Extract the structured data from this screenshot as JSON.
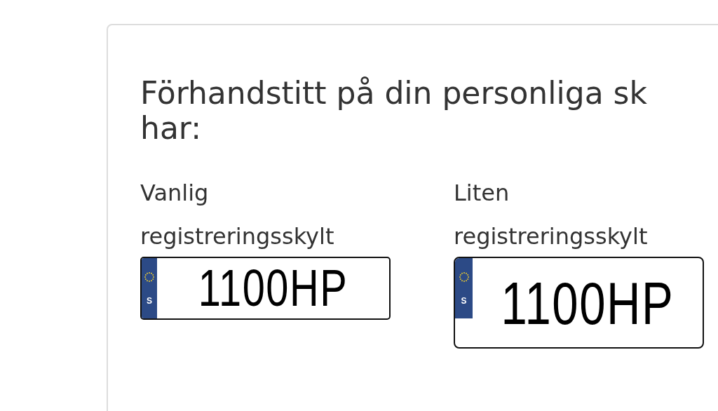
{
  "card": {
    "heading_lines": [
      "Förhandstitt på din personliga sk",
      "har:"
    ],
    "plates": [
      {
        "kind": "normal",
        "label_lines": [
          "Vanlig",
          "registreringsskylt"
        ],
        "country": "S",
        "number": "1100HP"
      },
      {
        "kind": "small",
        "label_lines": [
          "Liten",
          "registreringsskylt"
        ],
        "country": "S",
        "number": "1100HP"
      }
    ]
  }
}
